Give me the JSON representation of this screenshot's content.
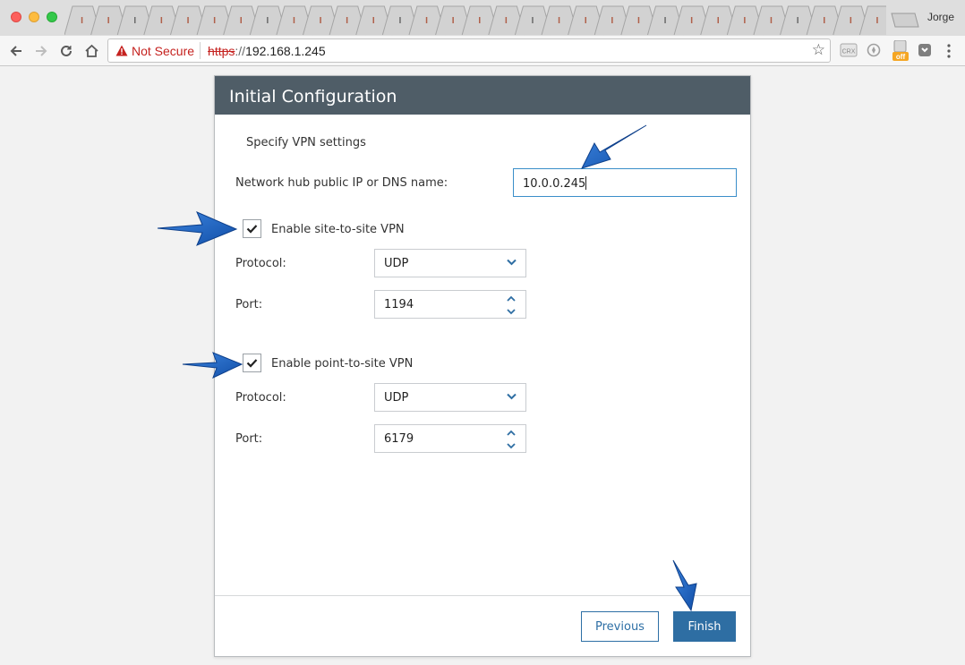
{
  "browser": {
    "profile_name": "Jorge",
    "security_label": "Not Secure",
    "url_scheme": "https",
    "url_separator": "://",
    "url_host": "192.168.1.245",
    "extensions": [
      "crx-icon",
      "compass-icon",
      "adblock-off-icon",
      "pocket-icon"
    ],
    "ext_badge": "off"
  },
  "dialog": {
    "title": "Initial Configuration",
    "subtitle": "Specify VPN settings",
    "hub_label": "Network hub public IP or DNS name:",
    "hub_value": "10.0.0.245",
    "site_to_site": {
      "checkbox_label": "Enable site-to-site VPN",
      "checked": true,
      "protocol_label": "Protocol:",
      "protocol_value": "UDP",
      "port_label": "Port:",
      "port_value": "1194"
    },
    "point_to_site": {
      "checkbox_label": "Enable point-to-site VPN",
      "checked": true,
      "protocol_label": "Protocol:",
      "protocol_value": "UDP",
      "port_label": "Port:",
      "port_value": "6179"
    },
    "previous_label": "Previous",
    "finish_label": "Finish"
  },
  "colors": {
    "header_bg": "#4f5d67",
    "primary_button": "#2e6ea3",
    "annotation_arrow": "#1f5fc0",
    "not_secure": "#c5221f"
  }
}
